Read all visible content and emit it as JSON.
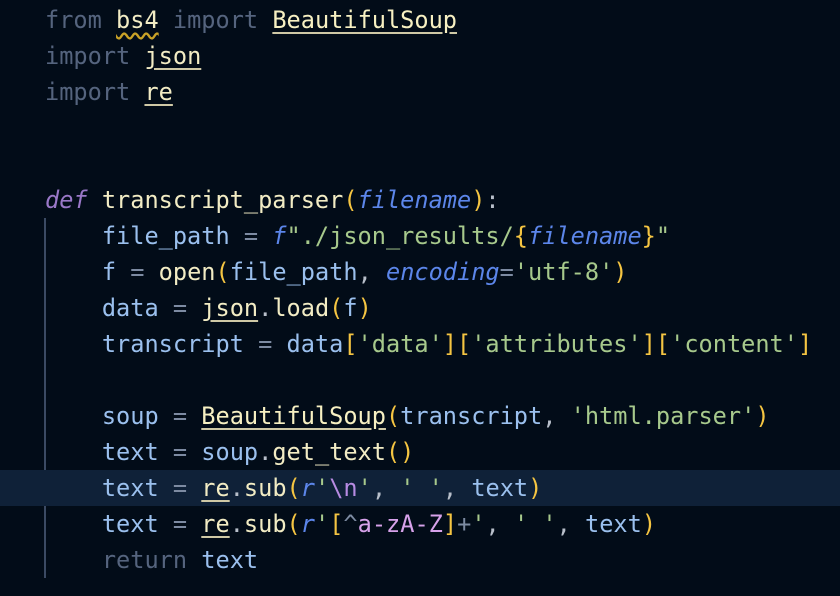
{
  "editor": {
    "language": "python",
    "highlighted_line": 14,
    "lines": [
      {
        "tokens": [
          {
            "t": "from",
            "c": "kw-imp"
          },
          {
            "t": " ",
            "c": "plain"
          },
          {
            "t": "bs4",
            "c": "mod-warn"
          },
          {
            "t": " ",
            "c": "plain"
          },
          {
            "t": "import",
            "c": "kw-imp"
          },
          {
            "t": " ",
            "c": "plain"
          },
          {
            "t": "BeautifulSoup",
            "c": "cls"
          }
        ]
      },
      {
        "tokens": [
          {
            "t": "import",
            "c": "kw-imp"
          },
          {
            "t": " ",
            "c": "plain"
          },
          {
            "t": "json",
            "c": "mod"
          }
        ]
      },
      {
        "tokens": [
          {
            "t": "import",
            "c": "kw-imp"
          },
          {
            "t": " ",
            "c": "plain"
          },
          {
            "t": "re",
            "c": "mod"
          }
        ]
      },
      {
        "tokens": []
      },
      {
        "tokens": []
      },
      {
        "tokens": [
          {
            "t": "def",
            "c": "kw-def"
          },
          {
            "t": " ",
            "c": "plain"
          },
          {
            "t": "transcript_parser",
            "c": "fn"
          },
          {
            "t": "(",
            "c": "paren"
          },
          {
            "t": "filename",
            "c": "param"
          },
          {
            "t": ")",
            "c": "paren"
          },
          {
            "t": ":",
            "c": "punc"
          }
        ]
      },
      {
        "tokens": [
          {
            "t": "    ",
            "c": "plain"
          },
          {
            "t": "file_path",
            "c": "var"
          },
          {
            "t": " = ",
            "c": "op"
          },
          {
            "t": "f",
            "c": "fprefix"
          },
          {
            "t": "\"./json_results/",
            "c": "fstr"
          },
          {
            "t": "{",
            "c": "brace"
          },
          {
            "t": "filename",
            "c": "param"
          },
          {
            "t": "}",
            "c": "brace"
          },
          {
            "t": "\"",
            "c": "fstr"
          }
        ]
      },
      {
        "tokens": [
          {
            "t": "    ",
            "c": "plain"
          },
          {
            "t": "f",
            "c": "var"
          },
          {
            "t": " = ",
            "c": "op"
          },
          {
            "t": "open",
            "c": "call"
          },
          {
            "t": "(",
            "c": "paren"
          },
          {
            "t": "file_path",
            "c": "var"
          },
          {
            "t": ", ",
            "c": "punc"
          },
          {
            "t": "encoding",
            "c": "param"
          },
          {
            "t": "=",
            "c": "op"
          },
          {
            "t": "'utf-8'",
            "c": "str"
          },
          {
            "t": ")",
            "c": "paren"
          }
        ]
      },
      {
        "tokens": [
          {
            "t": "    ",
            "c": "plain"
          },
          {
            "t": "data",
            "c": "var"
          },
          {
            "t": " = ",
            "c": "op"
          },
          {
            "t": "json",
            "c": "mod"
          },
          {
            "t": ".",
            "c": "punc"
          },
          {
            "t": "load",
            "c": "call"
          },
          {
            "t": "(",
            "c": "paren"
          },
          {
            "t": "f",
            "c": "var"
          },
          {
            "t": ")",
            "c": "paren"
          }
        ]
      },
      {
        "tokens": [
          {
            "t": "    ",
            "c": "plain"
          },
          {
            "t": "transcript",
            "c": "var"
          },
          {
            "t": " = ",
            "c": "op"
          },
          {
            "t": "data",
            "c": "var"
          },
          {
            "t": "[",
            "c": "brk"
          },
          {
            "t": "'data'",
            "c": "str"
          },
          {
            "t": "]",
            "c": "brk"
          },
          {
            "t": "[",
            "c": "brk"
          },
          {
            "t": "'attributes'",
            "c": "str"
          },
          {
            "t": "]",
            "c": "brk"
          },
          {
            "t": "[",
            "c": "brk"
          },
          {
            "t": "'content'",
            "c": "str"
          },
          {
            "t": "]",
            "c": "brk"
          }
        ]
      },
      {
        "tokens": []
      },
      {
        "tokens": [
          {
            "t": "    ",
            "c": "plain"
          },
          {
            "t": "soup",
            "c": "var"
          },
          {
            "t": " = ",
            "c": "op"
          },
          {
            "t": "BeautifulSoup",
            "c": "cls"
          },
          {
            "t": "(",
            "c": "paren"
          },
          {
            "t": "transcript",
            "c": "var"
          },
          {
            "t": ", ",
            "c": "punc"
          },
          {
            "t": "'html.parser'",
            "c": "str"
          },
          {
            "t": ")",
            "c": "paren"
          }
        ]
      },
      {
        "tokens": [
          {
            "t": "    ",
            "c": "plain"
          },
          {
            "t": "text",
            "c": "var"
          },
          {
            "t": " = ",
            "c": "op"
          },
          {
            "t": "soup",
            "c": "var"
          },
          {
            "t": ".",
            "c": "punc"
          },
          {
            "t": "get_text",
            "c": "call"
          },
          {
            "t": "()",
            "c": "paren"
          }
        ]
      },
      {
        "tokens": [
          {
            "t": "    ",
            "c": "plain"
          },
          {
            "t": "text",
            "c": "var"
          },
          {
            "t": " = ",
            "c": "op"
          },
          {
            "t": "re",
            "c": "mod"
          },
          {
            "t": ".",
            "c": "punc"
          },
          {
            "t": "sub",
            "c": "call"
          },
          {
            "t": "(",
            "c": "paren"
          },
          {
            "t": "r",
            "c": "fprefix"
          },
          {
            "t": "'",
            "c": "str"
          },
          {
            "t": "\\n",
            "c": "esc"
          },
          {
            "t": "'",
            "c": "str"
          },
          {
            "t": ", ",
            "c": "punc"
          },
          {
            "t": "' '",
            "c": "str"
          },
          {
            "t": ", ",
            "c": "punc"
          },
          {
            "t": "text",
            "c": "var"
          },
          {
            "t": ")",
            "c": "paren"
          }
        ]
      },
      {
        "tokens": [
          {
            "t": "    ",
            "c": "plain"
          },
          {
            "t": "text",
            "c": "var"
          },
          {
            "t": " = ",
            "c": "op"
          },
          {
            "t": "re",
            "c": "mod"
          },
          {
            "t": ".",
            "c": "punc"
          },
          {
            "t": "sub",
            "c": "call"
          },
          {
            "t": "(",
            "c": "paren"
          },
          {
            "t": "r",
            "c": "fprefix"
          },
          {
            "t": "'",
            "c": "str"
          },
          {
            "t": "[",
            "c": "brk"
          },
          {
            "t": "^",
            "c": "op"
          },
          {
            "t": "a-zA-Z",
            "c": "rx"
          },
          {
            "t": "]",
            "c": "brk"
          },
          {
            "t": "+",
            "c": "op"
          },
          {
            "t": "'",
            "c": "str"
          },
          {
            "t": ", ",
            "c": "punc"
          },
          {
            "t": "' '",
            "c": "str"
          },
          {
            "t": ", ",
            "c": "punc"
          },
          {
            "t": "text",
            "c": "var"
          },
          {
            "t": ")",
            "c": "paren"
          }
        ]
      },
      {
        "tokens": [
          {
            "t": "    ",
            "c": "plain"
          },
          {
            "t": "return",
            "c": "kw-ret"
          },
          {
            "t": " ",
            "c": "plain"
          },
          {
            "t": "text",
            "c": "var"
          }
        ]
      }
    ]
  },
  "colors": {
    "background": "#020c18",
    "current_line": "#0f2138",
    "indent_guide": "#3b4a63"
  }
}
